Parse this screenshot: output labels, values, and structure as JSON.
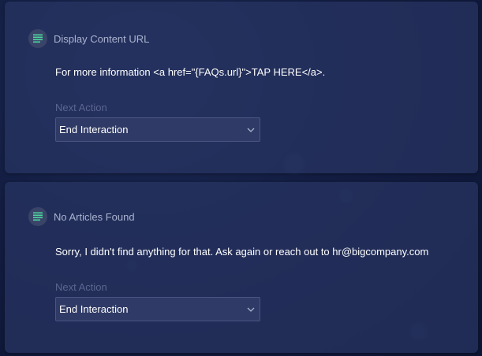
{
  "cards": [
    {
      "title": "Display Content URL",
      "text": "For more information <a href=\"{FAQs.url}\">TAP HERE</a>.",
      "next_action_label": "Next Action",
      "next_action_value": "End Interaction",
      "icon": "list-lines-icon"
    },
    {
      "title": "No Articles Found",
      "text": "Sorry, I didn't find anything for that. Ask again or reach out to hr@bigcompany.com",
      "next_action_label": "Next Action",
      "next_action_value": "End Interaction",
      "icon": "list-lines-icon"
    }
  ],
  "colors": {
    "icon_accent": "#4ed69e",
    "card_bg": "#283462",
    "label_muted": "#5b6690"
  }
}
